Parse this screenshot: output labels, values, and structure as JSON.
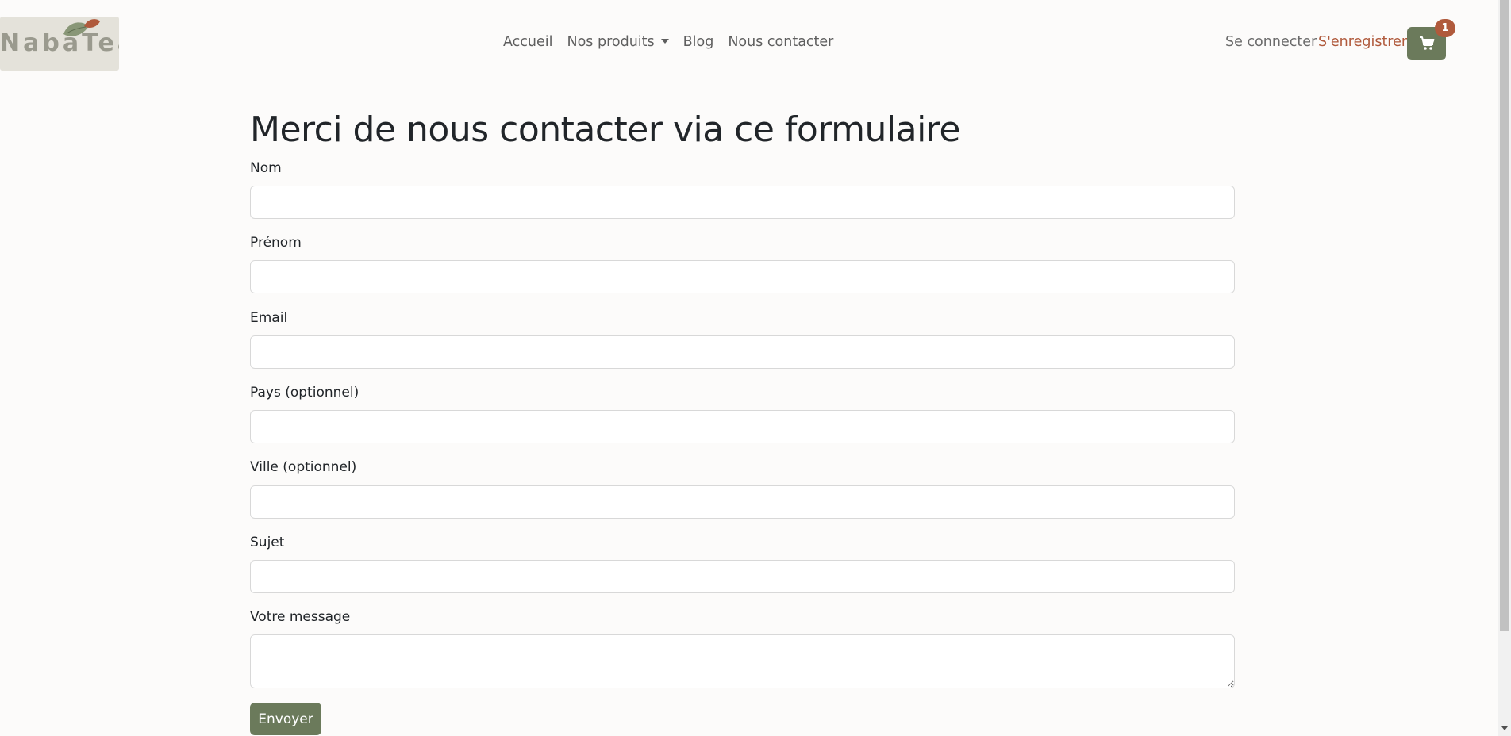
{
  "brand": {
    "logo_text": "NabaTea"
  },
  "nav": {
    "links": [
      {
        "label": "Accueil"
      },
      {
        "label": "Nos produits"
      },
      {
        "label": "Blog"
      },
      {
        "label": "Nous contacter"
      }
    ],
    "login": "Se connecter",
    "register": "S'enregistrer",
    "cart_count": "1"
  },
  "form": {
    "title": "Merci de nous contacter via ce formulaire",
    "fields": [
      {
        "label": "Nom",
        "value": ""
      },
      {
        "label": "Prénom",
        "value": ""
      },
      {
        "label": "Email",
        "value": ""
      },
      {
        "label": "Pays (optionnel)",
        "value": ""
      },
      {
        "label": "Ville (optionnel)",
        "value": ""
      },
      {
        "label": "Sujet",
        "value": ""
      },
      {
        "label": "Votre message",
        "value": ""
      }
    ],
    "submit": "Envoyer"
  },
  "colors": {
    "accent_green": "#6b7a5b",
    "accent_rust": "#b05a3c",
    "background": "#fcfbfa"
  }
}
